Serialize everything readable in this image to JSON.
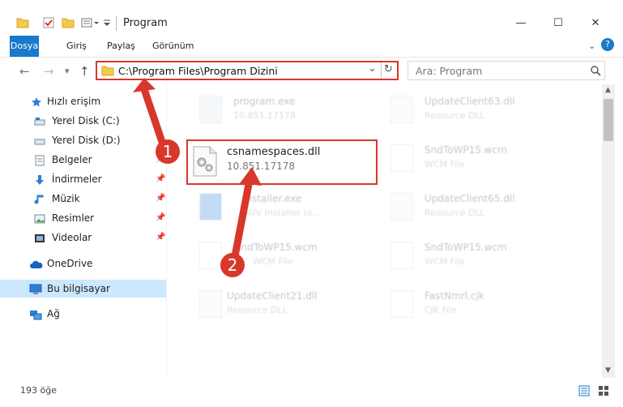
{
  "window": {
    "title": "Program",
    "minimize": "—",
    "maximize": "☐",
    "close": "✕"
  },
  "ribbon": {
    "tabs": [
      "Dosya",
      "Giriş",
      "Paylaş",
      "Görünüm"
    ],
    "help": "?"
  },
  "nav": {
    "back": "←",
    "forward": "→",
    "recent": "▾",
    "up": "↑"
  },
  "address": {
    "path": "C:\\Program Files\\Program Dizini",
    "dropdown": "⌄",
    "refresh": "↻"
  },
  "search": {
    "placeholder": "Ara: Program",
    "icon": "search-icon"
  },
  "sidebar": {
    "items": [
      {
        "label": "Hızlı erişim",
        "icon": "star-icon"
      },
      {
        "label": "Yerel Disk (C:)",
        "icon": "drive-icon"
      },
      {
        "label": "Yerel Disk (D:)",
        "icon": "drive-icon"
      },
      {
        "label": "Belgeler",
        "icon": "documents-icon",
        "pinned": true
      },
      {
        "label": "İndirmeler",
        "icon": "download-icon",
        "pinned": true
      },
      {
        "label": "Müzik",
        "icon": "music-icon",
        "pinned": true
      },
      {
        "label": "Resimler",
        "icon": "pictures-icon",
        "pinned": true
      },
      {
        "label": "Videolar",
        "icon": "videos-icon",
        "pinned": true
      },
      {
        "label": "OneDrive",
        "icon": "cloud-icon"
      },
      {
        "label": "Bu bilgisayar",
        "icon": "computer-icon",
        "selected": true
      },
      {
        "label": "Ağ",
        "icon": "network-icon"
      }
    ]
  },
  "files": [
    {
      "name": "program.exe",
      "sub": "10.851.17178"
    },
    {
      "name": "UpdateClient63.dll",
      "sub": "Resource DLL"
    },
    {
      "name": "SndToWP15.wcm",
      "sub": "WCM File"
    },
    {
      "name": "Installer.exe",
      "sub": "AUV Installer to..."
    },
    {
      "name": "UpdateClient65.dll",
      "sub": "Resource DLL"
    },
    {
      "name": "SndToWP15.wcm",
      "sub": "WCM File"
    },
    {
      "name": "SndToWP15.wcm",
      "sub": "WCM File"
    },
    {
      "name": "UpdateClient21.dll",
      "sub": "Resource DLL"
    },
    {
      "name": "FastNmrl.cjk",
      "sub": "CJK File"
    }
  ],
  "highlight_file": {
    "name": "csnamespaces.dll",
    "sub": "10.851.17178"
  },
  "annotations": {
    "step1": "1",
    "step2": "2"
  },
  "status": {
    "count": "193 öğe"
  },
  "colors": {
    "accent": "#1979ca",
    "annotation": "#d9372a",
    "selected": "#cce8ff"
  }
}
